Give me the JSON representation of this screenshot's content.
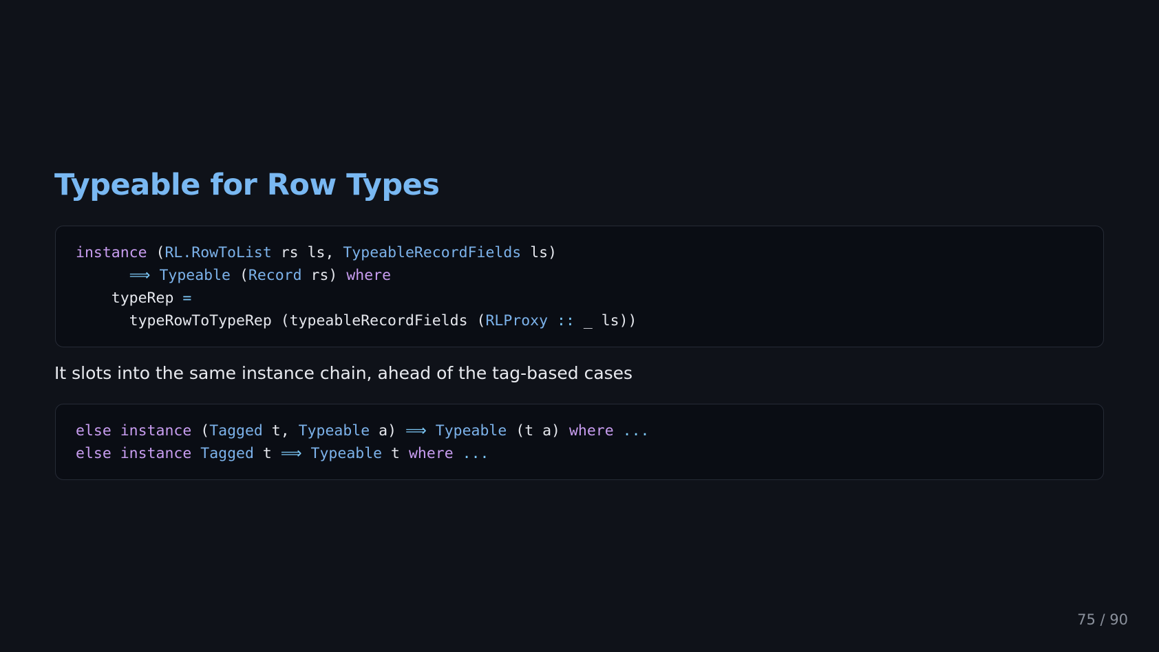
{
  "slide": {
    "title": "Typeable for Row Types",
    "paragraph": "It slots into the same instance chain, ahead of the tag-based cases",
    "page_number": "75 / 90"
  },
  "code_blocks": [
    {
      "lines": [
        [
          {
            "t": "kw",
            "v": "instance"
          },
          {
            "t": "tx",
            "v": " ("
          },
          {
            "t": "ty",
            "v": "RL.RowToList"
          },
          {
            "t": "tx",
            "v": " rs ls, "
          },
          {
            "t": "ty",
            "v": "TypeableRecordFields"
          },
          {
            "t": "tx",
            "v": " ls)"
          }
        ],
        [
          {
            "t": "tx",
            "v": "      "
          },
          {
            "t": "op",
            "v": "⟹"
          },
          {
            "t": "tx",
            "v": " "
          },
          {
            "t": "ty",
            "v": "Typeable"
          },
          {
            "t": "tx",
            "v": " ("
          },
          {
            "t": "ty",
            "v": "Record"
          },
          {
            "t": "tx",
            "v": " rs) "
          },
          {
            "t": "kw",
            "v": "where"
          }
        ],
        [
          {
            "t": "tx",
            "v": "    typeRep "
          },
          {
            "t": "op",
            "v": "="
          }
        ],
        [
          {
            "t": "tx",
            "v": "      typeRowToTypeRep (typeableRecordFields ("
          },
          {
            "t": "ty",
            "v": "RLProxy"
          },
          {
            "t": "tx",
            "v": " "
          },
          {
            "t": "op",
            "v": "::"
          },
          {
            "t": "tx",
            "v": " _ ls))"
          }
        ]
      ]
    },
    {
      "lines": [
        [
          {
            "t": "kw",
            "v": "else"
          },
          {
            "t": "tx",
            "v": " "
          },
          {
            "t": "kw",
            "v": "instance"
          },
          {
            "t": "tx",
            "v": " ("
          },
          {
            "t": "ty",
            "v": "Tagged"
          },
          {
            "t": "tx",
            "v": " t, "
          },
          {
            "t": "ty",
            "v": "Typeable"
          },
          {
            "t": "tx",
            "v": " a) "
          },
          {
            "t": "op",
            "v": "⟹"
          },
          {
            "t": "tx",
            "v": " "
          },
          {
            "t": "ty",
            "v": "Typeable"
          },
          {
            "t": "tx",
            "v": " (t a) "
          },
          {
            "t": "kw",
            "v": "where"
          },
          {
            "t": "tx",
            "v": " "
          },
          {
            "t": "op",
            "v": "..."
          }
        ],
        [
          {
            "t": "kw",
            "v": "else"
          },
          {
            "t": "tx",
            "v": " "
          },
          {
            "t": "kw",
            "v": "instance"
          },
          {
            "t": "tx",
            "v": " "
          },
          {
            "t": "ty",
            "v": "Tagged"
          },
          {
            "t": "tx",
            "v": " t "
          },
          {
            "t": "op",
            "v": "⟹"
          },
          {
            "t": "tx",
            "v": " "
          },
          {
            "t": "ty",
            "v": "Typeable"
          },
          {
            "t": "tx",
            "v": " t "
          },
          {
            "t": "kw",
            "v": "where"
          },
          {
            "t": "tx",
            "v": " "
          },
          {
            "t": "op",
            "v": "..."
          }
        ]
      ]
    }
  ],
  "colors": {
    "background": "#0f1219",
    "title": "#79b8f2",
    "keyword": "#c89df0",
    "type": "#7cb2ea",
    "operator": "#7cc6f5",
    "text": "#e6e8ee",
    "page_number": "#8b919c"
  }
}
